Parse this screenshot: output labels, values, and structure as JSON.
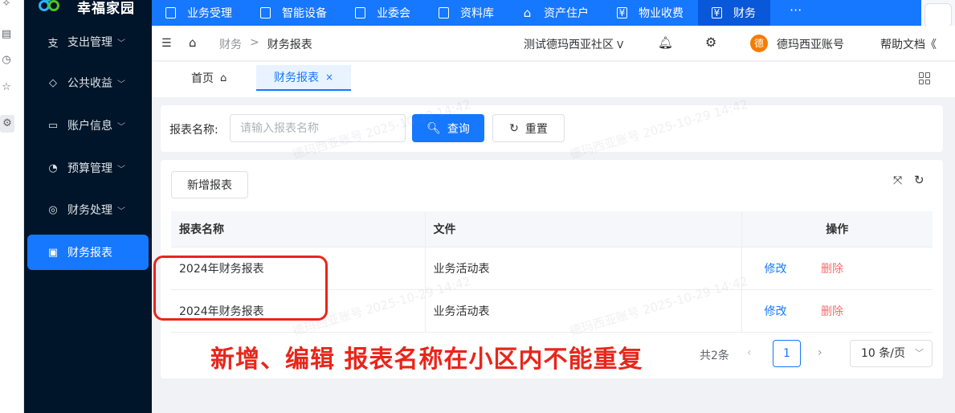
{
  "app": {
    "name": "幸福家园"
  },
  "topnav": {
    "items": [
      {
        "label": "业务受理",
        "icon": "document-icon",
        "glyph": "文"
      },
      {
        "label": "智能设备",
        "icon": "device-icon",
        "glyph": "▫"
      },
      {
        "label": "业委会",
        "icon": "committee-icon",
        "glyph": "≡"
      },
      {
        "label": "资料库",
        "icon": "library-icon",
        "glyph": "▯"
      },
      {
        "label": "资产住户",
        "icon": "home-icon",
        "glyph": "⌂"
      },
      {
        "label": "物业收费",
        "icon": "fee-icon",
        "glyph": "¥"
      },
      {
        "label": "财务",
        "icon": "finance-icon",
        "glyph": "¥"
      }
    ],
    "more": "···"
  },
  "sidebar": {
    "items": [
      {
        "label": "支出管理",
        "glyph": "支"
      },
      {
        "label": "公共收益",
        "glyph": "◇"
      },
      {
        "label": "账户信息",
        "glyph": "▭"
      },
      {
        "label": "预算管理",
        "glyph": "◔"
      },
      {
        "label": "财务处理",
        "glyph": "◎"
      },
      {
        "label": "财务报表",
        "glyph": "▣"
      }
    ],
    "chevron": "﹀"
  },
  "header": {
    "breadcrumb": {
      "parent": "财务",
      "sep": ">",
      "current": "财务报表"
    },
    "community": "测试德玛西亚社区",
    "community_chevron": "V",
    "avatar_text": "德",
    "account": "德玛西亚账号",
    "help": "帮助文档《"
  },
  "tabs": {
    "home": "首页",
    "current": "财务报表",
    "close": "×"
  },
  "search": {
    "label": "报表名称:",
    "placeholder": "请输入报表名称",
    "query_label": "查询",
    "reset_label": "重置"
  },
  "table": {
    "add_label": "新增报表",
    "columns": [
      "报表名称",
      "文件",
      "操作"
    ],
    "rows": [
      {
        "name": "2024年财务报表",
        "file": "业务活动表",
        "edit": "修改",
        "delete": "删除"
      },
      {
        "name": "2024年财务报表",
        "file": "业务活动表",
        "edit": "修改",
        "delete": "删除"
      }
    ]
  },
  "pagination": {
    "total": "共2条",
    "current_page": "1",
    "page_size": "10 条/页"
  },
  "annotation": {
    "text": "新增、编辑 报表名称在小区内不能重复",
    "color": "#e8261b"
  },
  "watermark": {
    "text": "德玛西亚账号 2025-10-29 14:42"
  },
  "colors": {
    "primary": "#1677ff",
    "sidebar": "#001529",
    "danger": "#f56c6c"
  }
}
